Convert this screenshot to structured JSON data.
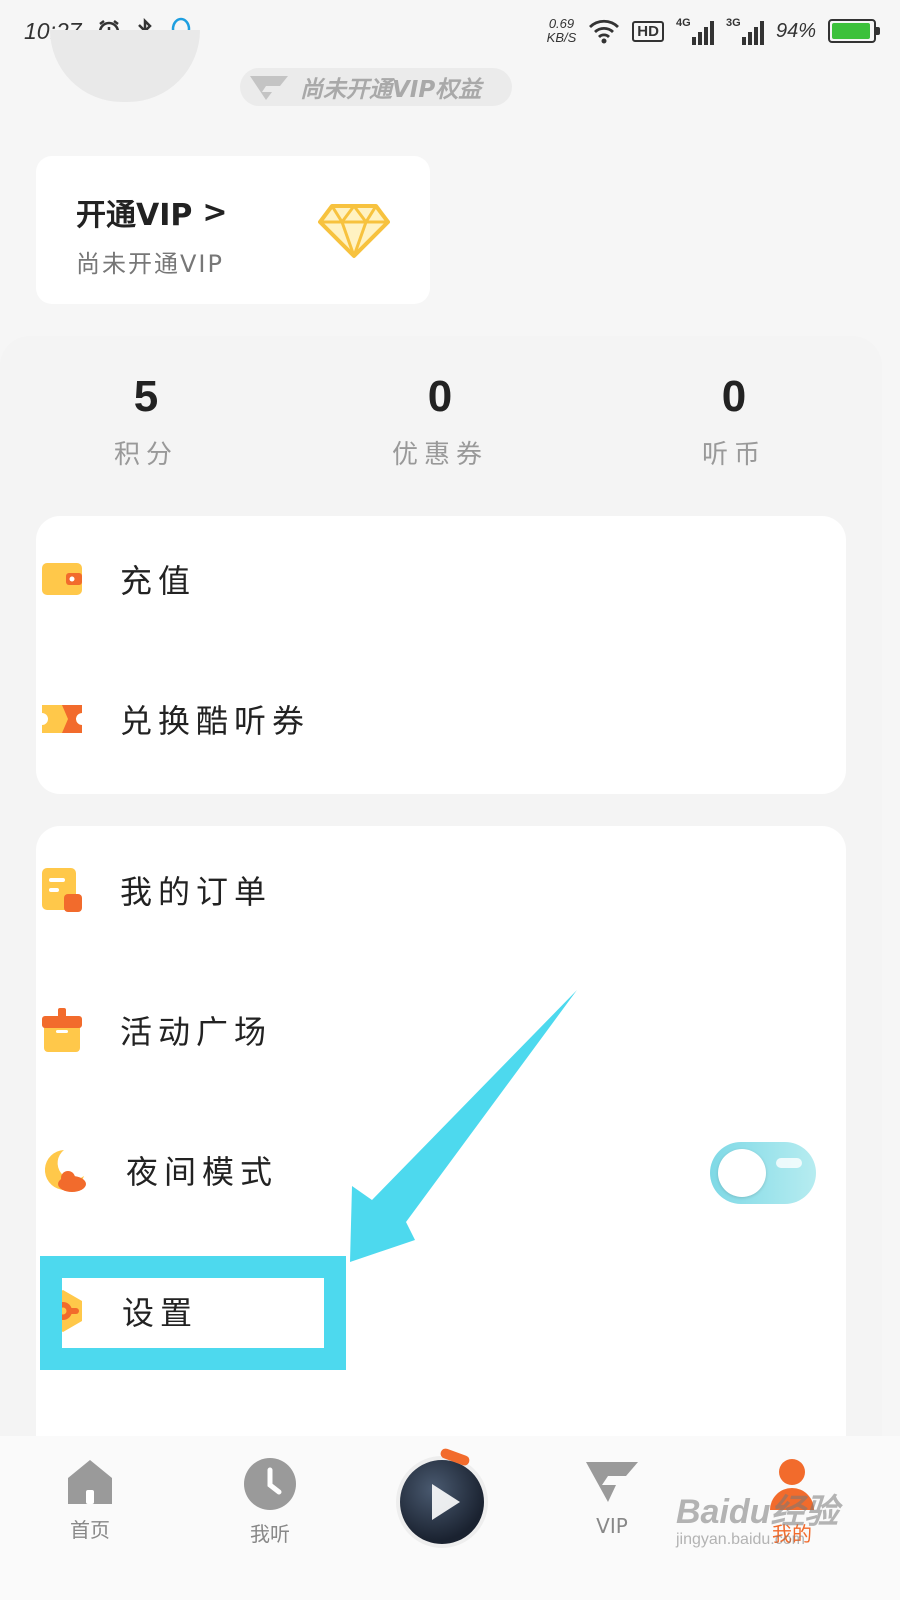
{
  "status_bar": {
    "time": "10:27",
    "net_speed_value": "0.69",
    "net_speed_unit": "KB/S",
    "hd": "HD",
    "signal_1": "4G",
    "signal_2": "3G",
    "battery": "94%",
    "battery_level": 0.94
  },
  "header": {
    "vip_status": "尚未开通VIP权益"
  },
  "vip_card": {
    "title": "开通VIP",
    "chevron": ">",
    "subtitle": "尚未开通VIP"
  },
  "stats": [
    {
      "value": "5",
      "label": "积分"
    },
    {
      "value": "0",
      "label": "优惠券"
    },
    {
      "value": "0",
      "label": "听币"
    }
  ],
  "menu_group_1": [
    {
      "label": "充值",
      "icon": "wallet-icon"
    },
    {
      "label": "兑换酷听券",
      "icon": "ticket-icon"
    }
  ],
  "menu_group_2": [
    {
      "label": "我的订单",
      "icon": "order-icon"
    },
    {
      "label": "活动广场",
      "icon": "gift-icon"
    },
    {
      "label": "夜间模式",
      "icon": "moon-icon"
    },
    {
      "label": "设置",
      "icon": "settings-icon"
    }
  ],
  "night_mode": {
    "enabled": false
  },
  "bottom_nav": [
    {
      "label": "首页",
      "icon": "home-icon"
    },
    {
      "label": "我听",
      "icon": "clock-icon"
    },
    {
      "label": "VIP",
      "icon": "vip-icon"
    },
    {
      "label": "我的",
      "icon": "profile-icon",
      "active": true
    }
  ],
  "watermark": {
    "line1": "Baidu经验",
    "line2": "jingyan.baidu.com"
  },
  "colors": {
    "accent": "#f26b2c",
    "icon_yellow": "#ffc84a",
    "annotation": "#4dd9ee",
    "toggle": "#9fe3ec"
  }
}
